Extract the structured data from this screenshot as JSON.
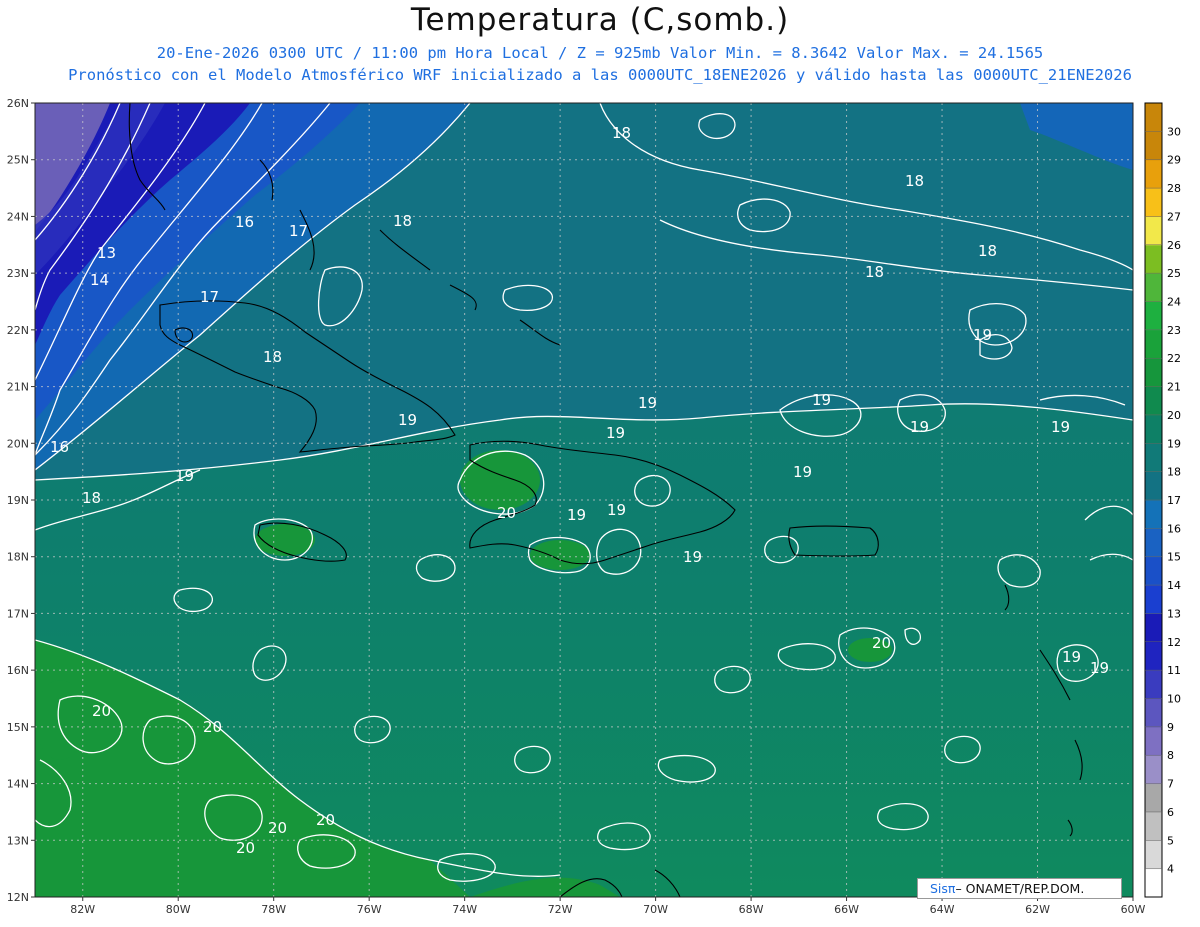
{
  "header": {
    "title": "Temperatura (C,somb.)",
    "subtitle_1": "20-Ene-2026  0300 UTC / 11:00 pm Hora Local / Z = 925mb    Valor Min. = 8.3642  Valor Max. = 24.1565",
    "subtitle_2": "Pronóstico con el Modelo Atmosférico WRF inicializado a las 0000UTC_18ENE2026 y válido hasta las  0000UTC_21ENE2026"
  },
  "map": {
    "lon_range": [
      -83,
      -60
    ],
    "lat_range": [
      12,
      26
    ],
    "x_tick_labels": [
      "82W",
      "80W",
      "78W",
      "76W",
      "74W",
      "72W",
      "70W",
      "68W",
      "66W",
      "64W",
      "62W",
      "60W"
    ],
    "y_tick_labels": [
      "12N",
      "13N",
      "14N",
      "15N",
      "16N",
      "17N",
      "18N",
      "19N",
      "20N",
      "21N",
      "22N",
      "23N",
      "24N",
      "25N",
      "26N"
    ],
    "contour_labels": [
      "18",
      "18",
      "18",
      "18",
      "18",
      "17",
      "16",
      "13",
      "14",
      "17",
      "18",
      "19",
      "19",
      "19",
      "19",
      "19",
      "19",
      "19",
      "19",
      "19",
      "19",
      "16",
      "18",
      "19",
      "20",
      "19",
      "19",
      "20",
      "19",
      "20",
      "20",
      "20",
      "20",
      "20"
    ],
    "colors": {
      "ocean_main": "#0e7d6f",
      "warm_green": "#17963a",
      "cool_teal": "#137283",
      "blue_18": "#1269b2",
      "blue_16": "#1857c6",
      "dark_blue": "#1a1bb7",
      "purple": "#6a5fb8",
      "contour": "#ffffff",
      "coast": "#000000"
    }
  },
  "colorbar": {
    "labels": [
      "4",
      "5",
      "6",
      "7",
      "8",
      "9",
      "10",
      "11",
      "12",
      "13",
      "14",
      "15",
      "16",
      "17",
      "18",
      "19",
      "20",
      "21",
      "22",
      "23",
      "24",
      "25",
      "26",
      "27",
      "28",
      "29",
      "30"
    ],
    "colors": [
      "#ffffff",
      "#d9d9d9",
      "#c0c0c0",
      "#a8a8a8",
      "#9a8fc8",
      "#7e70c2",
      "#5c56bf",
      "#3a3cbf",
      "#1f24c0",
      "#1a1bb7",
      "#1a3fd0",
      "#1a50c8",
      "#1a62c2",
      "#1472b8",
      "#137283",
      "#117a78",
      "#0e8066",
      "#108a4e",
      "#16963c",
      "#1aa23a",
      "#1eb040",
      "#4fb63a",
      "#7cbe22",
      "#f2e84a",
      "#f8c018",
      "#e8a00c",
      "#c8860a"
    ]
  },
  "credit": {
    "brand": "Sisπ",
    "text": "– ONAMET/REP.DOM."
  }
}
